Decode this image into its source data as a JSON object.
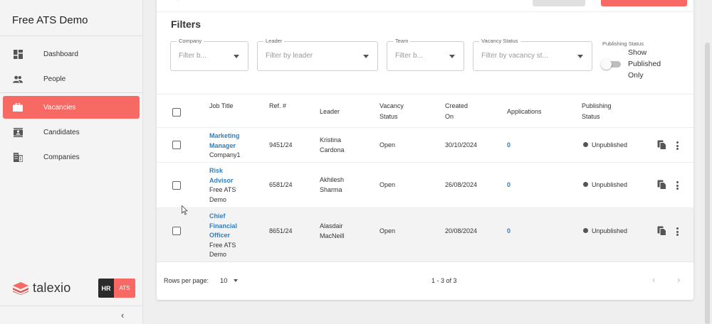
{
  "app": {
    "title": "Free ATS Demo"
  },
  "sidebar": {
    "items": [
      {
        "label": "Dashboard",
        "icon": "dashboard-icon",
        "active": false
      },
      {
        "label": "People",
        "icon": "people-icon",
        "active": false
      },
      {
        "label": "Vacancies",
        "icon": "briefcase-icon",
        "active": true
      },
      {
        "label": "Candidates",
        "icon": "candidate-card-icon",
        "active": false
      },
      {
        "label": "Companies",
        "icon": "building-icon",
        "active": false
      }
    ],
    "brand": {
      "name": "talexio",
      "badge_left": "HR",
      "badge_right": "ATS"
    },
    "collapse_glyph": "‹"
  },
  "filters": {
    "title": "Filters",
    "company": {
      "label": "Company",
      "placeholder": "Filter b..."
    },
    "leader": {
      "label": "Leader",
      "placeholder": "Filter by leader"
    },
    "team": {
      "label": "Team",
      "placeholder": "Filter b..."
    },
    "vacancy_status": {
      "label": "Vacancy Status",
      "placeholder": "Filter by vacancy st..."
    },
    "publishing_status": {
      "label": "Publishing Status",
      "toggle_text": "Show Published Only",
      "toggle_on": false
    }
  },
  "table": {
    "headers": {
      "job_title": "Job Title",
      "ref": "Ref. #",
      "leader": "Leader",
      "vacancy_status": "Vacancy Status",
      "created_on": "Created On",
      "applications": "Applications",
      "publishing_status": "Publishing Status"
    },
    "rows": [
      {
        "job": "Marketing Manager",
        "company": "Company1",
        "ref": "9451/24",
        "leader": "Kristina Cardona",
        "status": "Open",
        "created": "30/10/2024",
        "applications": "0",
        "publishing": "Unpublished"
      },
      {
        "job": "Risk Advisor",
        "company": "Free ATS Demo",
        "ref": "6581/24",
        "leader": "Akhilesh Sharma",
        "status": "Open",
        "created": "26/08/2024",
        "applications": "0",
        "publishing": "Unpublished"
      },
      {
        "job": "Chief Financial Officer",
        "company": "Free ATS Demo",
        "ref": "8651/24",
        "leader": "Alasdair MacNeill",
        "status": "Open",
        "created": "20/08/2024",
        "applications": "0",
        "publishing": "Unpublished"
      }
    ]
  },
  "pagination": {
    "rows_per_page_label": "Rows per page:",
    "rows_per_page": "10",
    "range": "1 - 3 of 3",
    "prev_glyph": "‹",
    "next_glyph": "›"
  },
  "colors": {
    "accent": "#f76a63",
    "link": "#2f7fc2"
  }
}
